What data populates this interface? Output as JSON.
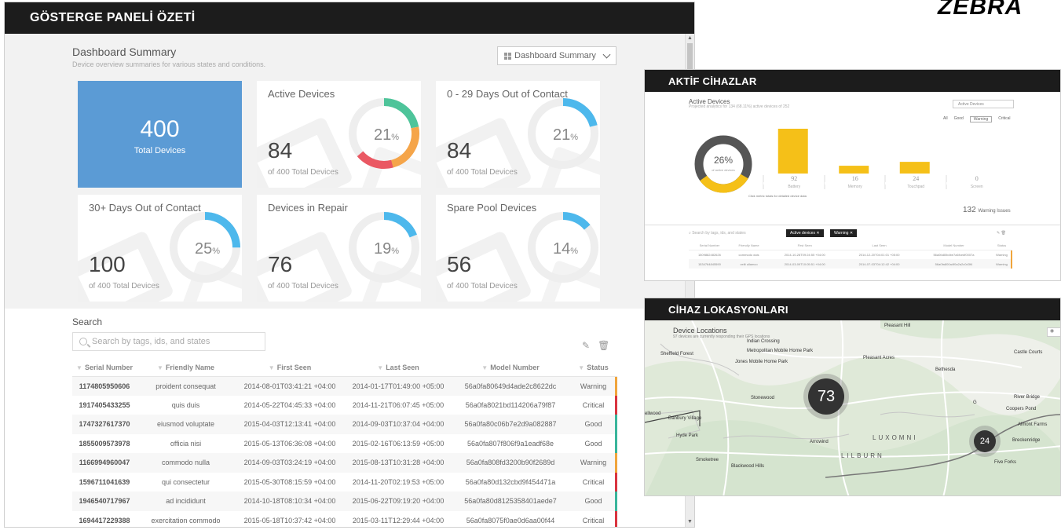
{
  "brand": {
    "logo": "ZEBRA"
  },
  "main": {
    "header": "GÖSTERGE PANELİ ÖZETİ",
    "title": "Dashboard Summary",
    "subtitle": "Device overview summaries for various states and conditions.",
    "select": "Dashboard Summary",
    "total": {
      "value": "400",
      "label": "Total Devices"
    },
    "tiles": [
      {
        "title": "Active Devices",
        "value": "84",
        "of": "of 400 Total Devices",
        "pct": "21",
        "unit": "%"
      },
      {
        "title": "0 - 29 Days Out of Contact",
        "value": "84",
        "of": "of 400 Total Devices",
        "pct": "21",
        "unit": "%"
      },
      {
        "title": "30+ Days Out of Contact",
        "value": "100",
        "of": "of 400 Total Devices",
        "pct": "25",
        "unit": "%"
      },
      {
        "title": "Devices in Repair",
        "value": "76",
        "of": "of 400 Total Devices",
        "pct": "19",
        "unit": "%"
      },
      {
        "title": "Spare Pool Devices",
        "value": "56",
        "of": "of 400 Total Devices",
        "pct": "14",
        "unit": "%"
      }
    ],
    "search": {
      "title": "Search",
      "placeholder": "Search by tags, ids, and states",
      "edit_icon": "pencil-icon",
      "delete_icon": "trash-icon"
    },
    "table": {
      "headers": [
        "Serial Number",
        "Friendly Name",
        "First Seen",
        "Last Seen",
        "Model Number",
        "Status"
      ],
      "rows": [
        [
          "1174805950606",
          "proident consequat",
          "2014-08-01T03:41:21 +04:00",
          "2014-01-17T01:49:00 +05:00",
          "56a0fa80649d4ade2c8622dc",
          "Warning"
        ],
        [
          "1917405433255",
          "quis duis",
          "2014-05-22T04:45:33 +04:00",
          "2014-11-21T06:07:45 +05:00",
          "56a0fa8021bd114206a79f87",
          "Critical"
        ],
        [
          "1747327617370",
          "eiusmod voluptate",
          "2015-04-03T12:13:41 +04:00",
          "2014-09-03T10:37:04 +04:00",
          "56a0fa80c06b7e2d9a082887",
          "Good"
        ],
        [
          "1855009573978",
          "officia nisi",
          "2015-05-13T06:36:08 +04:00",
          "2015-02-16T06:13:59 +05:00",
          "56a0fa807f806f9a1eadf68e",
          "Good"
        ],
        [
          "1166994960047",
          "commodo nulla",
          "2014-09-03T03:24:19 +04:00",
          "2015-08-13T10:31:28 +04:00",
          "56a0fa808fd3200b90f2689d",
          "Warning"
        ],
        [
          "1596711041639",
          "qui consectetur",
          "2015-05-30T08:15:59 +04:00",
          "2014-11-20T02:19:53 +05:00",
          "56a0fa80d132cbd9f454471a",
          "Critical"
        ],
        [
          "1946540717967",
          "ad incididunt",
          "2014-10-18T08:10:34 +04:00",
          "2015-06-22T09:19:20 +04:00",
          "56a0fa80d8125358401aede7",
          "Good"
        ],
        [
          "1694417229388",
          "exercitation commodo",
          "2015-05-18T10:37:42 +04:00",
          "2015-03-11T12:29:44 +04:00",
          "56a0fa8075f0ae0d6aa00f44",
          "Critical"
        ]
      ]
    }
  },
  "status_colors": {
    "Warning": "#f0a53c",
    "Critical": "#d9343f",
    "Good": "#39b59a"
  },
  "active_panel": {
    "header": "AKTİF CİHAZLAR",
    "title": "Active Devices",
    "subtitle": "Projected analytics for 134 (68.11%) active devices of 252",
    "select": "Active Devices",
    "filters": [
      "All",
      "Good",
      "Warning",
      "Critical"
    ],
    "donut": {
      "value": "26%",
      "label": "of active devices"
    },
    "bars": [
      {
        "name": "Battery",
        "value": 92
      },
      {
        "name": "Memory",
        "value": 16
      },
      {
        "name": "Touchpad",
        "value": 24
      },
      {
        "name": "Screen",
        "value": 0
      }
    ],
    "bar_color": "#f5c018",
    "hint": "Click metric totals for detailed device data",
    "issues": {
      "count": "132",
      "label": "Warning Issues"
    },
    "search_placeholder": "Search by tags, ids, and states",
    "chips": [
      "Active devices",
      "Warning"
    ],
    "table": {
      "headers": [
        "Serial Number",
        "Friendly Name",
        "First Seen",
        "Last Seen",
        "Model Number",
        "Status"
      ],
      "rows": [
        [
          "1509882482626",
          "commodo duis",
          "2014-10-28T09:24:55 +04:00",
          "2014-12-20T04:01:01 +05:00",
          "56a0fa80bdbe7a6fcedf0007a",
          "Warning"
        ],
        [
          "1534764845590",
          "velit ullamco",
          "2014-03-09T10:05:51 +04:00",
          "2014-07-03T04:12:42 +04:00",
          "56a0fa800a4f0a2a2c0d3f4",
          "Warning"
        ]
      ]
    }
  },
  "location_panel": {
    "header": "CİHAZ LOKASYONLARI",
    "title": "Device Locations",
    "subtitle": "97 devices are currently responding their GPS locations",
    "places": [
      "Pleasant Hill",
      "Indian Crossing",
      "Metropolitan Mobile Home Park",
      "Sheffield Forest",
      "Jones Mobile Home Park",
      "Pleasant Acres",
      "Bethesda",
      "Castle Courts",
      "Stonewood",
      "River Bridge",
      "Coopers Pond",
      "Danbury Village",
      "Almont Farms",
      "Hyde Park",
      "Arrowind",
      "Breckenridge",
      "Smoketree",
      "Blackwood Hills",
      "Five Forks",
      "LUXOMNI",
      "LILBURN",
      "ellwood",
      "G"
    ],
    "clusters": [
      {
        "value": "73"
      },
      {
        "value": "24"
      }
    ]
  }
}
